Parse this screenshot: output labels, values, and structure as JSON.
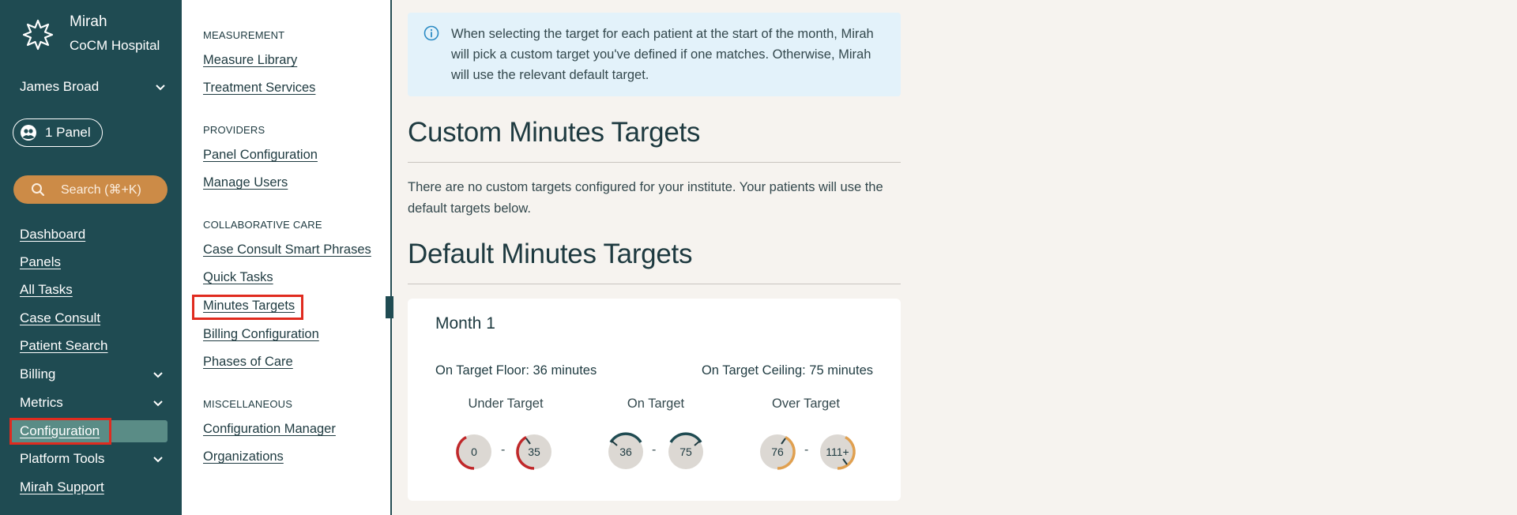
{
  "sidebar": {
    "brand_name": "Mirah",
    "institute": "CoCM Hospital",
    "user": "James Broad",
    "panel_label": "1 Panel",
    "search_label": "Search  (⌘+K)",
    "nav": [
      {
        "label": "Dashboard",
        "icon": ""
      },
      {
        "label": "Panels",
        "icon": ""
      },
      {
        "label": "All Tasks",
        "icon": ""
      },
      {
        "label": "Case Consult",
        "icon": ""
      },
      {
        "label": "Patient Search",
        "icon": ""
      },
      {
        "label": "Billing",
        "icon": "chevron-down-icon"
      },
      {
        "label": "Metrics",
        "icon": "chevron-down-icon"
      },
      {
        "label": "Configuration",
        "icon": ""
      },
      {
        "label": "Platform Tools",
        "icon": "chevron-down-icon"
      },
      {
        "label": "Mirah Support",
        "icon": ""
      }
    ]
  },
  "subnav": {
    "sections": [
      {
        "heading": "MEASUREMENT",
        "links": [
          "Measure Library",
          "Treatment Services"
        ]
      },
      {
        "heading": "PROVIDERS",
        "links": [
          "Panel Configuration",
          "Manage Users"
        ]
      },
      {
        "heading": "COLLABORATIVE CARE",
        "links": [
          "Case Consult Smart Phrases",
          "Quick Tasks",
          "Minutes Targets",
          "Billing Configuration",
          "Phases of Care"
        ]
      },
      {
        "heading": "MISCELLANEOUS",
        "links": [
          "Configuration Manager",
          "Organizations"
        ]
      }
    ]
  },
  "main": {
    "info": "When selecting the target for each patient at the start of the month, Mirah will pick a custom target you've defined if one matches. Otherwise, Mirah will use the relevant default target.",
    "custom_title": "Custom Minutes Targets",
    "custom_desc": "There are no custom targets configured for your institute. Your patients will use the default targets below.",
    "default_title": "Default Minutes Targets",
    "card": {
      "month": "Month 1",
      "floor": "On Target Floor: 36 minutes",
      "ceiling": "On Target Ceiling: 75 minutes",
      "groups": [
        {
          "label": "Under Target",
          "from": "0",
          "to": "35"
        },
        {
          "label": "On Target",
          "from": "36",
          "to": "75"
        },
        {
          "label": "Over Target",
          "from": "76",
          "to": "111+"
        }
      ],
      "dash": "-"
    }
  },
  "colors": {
    "sidebar_bg": "#1f4b52",
    "search_bg": "#cc8b47",
    "active_nav_bg": "#5a8c86",
    "highlight": "#e02b1f",
    "under_target": "#c0282a",
    "on_target": "#1f4b52",
    "over_target": "#e0a050",
    "info_bg": "#e3f2fa"
  }
}
